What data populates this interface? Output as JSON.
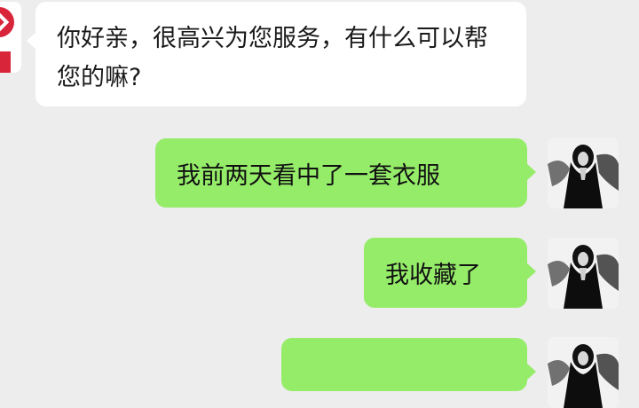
{
  "messages": [
    {
      "side": "left",
      "text": "你好亲，很高兴为您服务，有什么可以帮您的嘛?"
    },
    {
      "side": "right",
      "text": "我前两天看中了一套衣服"
    },
    {
      "side": "right",
      "text": "我收藏了"
    },
    {
      "side": "right",
      "text": ""
    }
  ],
  "colors": {
    "background": "#ededed",
    "incoming_bubble": "#ffffff",
    "outgoing_bubble": "#95ec69",
    "shop_brand": "#d8253a"
  },
  "icons": {
    "shop_avatar": "shop-logo-icon",
    "user_avatar": "user-avatar-image"
  }
}
